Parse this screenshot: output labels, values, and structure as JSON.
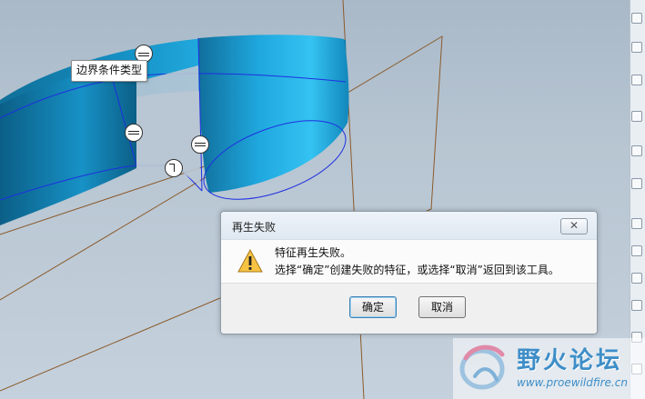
{
  "viewport": {
    "tooltip": "边界条件类型"
  },
  "dialog": {
    "title": "再生失败",
    "close_glyph": "✕",
    "message_line1": "特征再生失败。",
    "message_line2": "选择“确定”创建失败的特征，或选择“取消”返回到该工具。",
    "ok_label": "确定",
    "cancel_label": "取消",
    "icon": "warning-icon"
  },
  "watermark": {
    "title": "野火论坛",
    "url": "www.proewildfire.cn"
  },
  "colors": {
    "viewport_bg": "#b7c5d2",
    "surface_blue": "#1aa3d8",
    "datum_brown": "#8b5a2b",
    "edge_blue": "#1e2fe0",
    "watermark_blue": "#3e8ec8"
  }
}
